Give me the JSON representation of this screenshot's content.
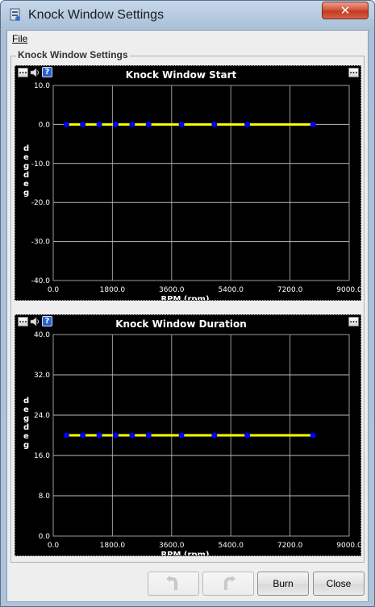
{
  "window": {
    "title": "Knock Window Settings"
  },
  "menu": {
    "file": "File"
  },
  "group": {
    "title": "Knock Window Settings"
  },
  "colors": {
    "line": "#ffff00",
    "point": "#0000ff",
    "grid": "#ffffff",
    "background": "#000000"
  },
  "panels": [
    {
      "title": "Knock Window Start",
      "ylabel": "deg deg",
      "y_ticks": [
        "10.0",
        "0.0",
        "-10.0",
        "-20.0",
        "-30.0",
        "-40.0"
      ],
      "x_ticks": [
        "0.0",
        "1800.0",
        "3600.0",
        "5400.0",
        "7200.0",
        "9000.0"
      ],
      "xlabel": "RPM (rpm)"
    },
    {
      "title": "Knock Window Duration",
      "ylabel": "deg deg",
      "y_ticks": [
        "40.0",
        "32.0",
        "24.0",
        "16.0",
        "8.0",
        "0.0"
      ],
      "x_ticks": [
        "0.0",
        "1800.0",
        "3600.0",
        "5400.0",
        "7200.0",
        "9000.0"
      ],
      "xlabel": "RPM (rpm)"
    }
  ],
  "chart_data": [
    {
      "type": "line",
      "title": "Knock Window Start",
      "xlabel": "RPM (rpm)",
      "ylabel": "deg deg",
      "xlim": [
        0,
        9000
      ],
      "ylim": [
        -40,
        10
      ],
      "grid": true,
      "x": [
        400,
        900,
        1400,
        1900,
        2400,
        2900,
        3900,
        4900,
        5900,
        7900
      ],
      "y": [
        0,
        0,
        0,
        0,
        0,
        0,
        0,
        0,
        0,
        0
      ]
    },
    {
      "type": "line",
      "title": "Knock Window Duration",
      "xlabel": "RPM (rpm)",
      "ylabel": "deg deg",
      "xlim": [
        0,
        9000
      ],
      "ylim": [
        0,
        40
      ],
      "grid": true,
      "x": [
        400,
        900,
        1400,
        1900,
        2400,
        2900,
        3900,
        4900,
        5900,
        7900
      ],
      "y": [
        20,
        20,
        20,
        20,
        20,
        20,
        20,
        20,
        20,
        20
      ]
    }
  ],
  "buttons": {
    "undo": "undo-icon",
    "redo": "redo-icon",
    "burn": "Burn",
    "close": "Close"
  }
}
